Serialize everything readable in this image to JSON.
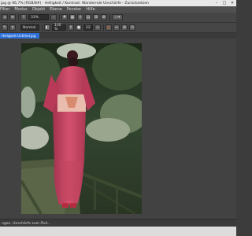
{
  "window": {
    "title": "jpg @ 66,7% (RGB/8#) - Helligkeit / Kontrast: Wandernde Unschärfe - Zurücksetzen",
    "minimize": "–",
    "maximize": "□",
    "close": "✕"
  },
  "menu": [
    "Filter",
    "Modus",
    "Objekt",
    "Ebene",
    "Fenster",
    "Hilfe"
  ],
  "toolbar1": {
    "zoom_value": "33%",
    "icons": [
      "home-icon",
      "menu-icon",
      "arrow-icon",
      "zoom-out-icon",
      "grid-icon",
      "settings-icon",
      "view-icon"
    ]
  },
  "toolbar2": {
    "mode_value": "Normal",
    "opacity_value": "100 %",
    "size_value": "22",
    "icons": [
      "brush-icon",
      "mode-icon",
      "link-icon",
      "target-icon"
    ]
  },
  "tab": {
    "label": "Helligkeit-Untitled.jpg"
  },
  "status": {
    "text": "ngen, Unschärfe zum Änd..."
  },
  "colors": {
    "chrome": "#3c3c3c",
    "tab_active": "#2b6ed8",
    "kimono": "#c0435f",
    "obi": "#e8b8a8"
  }
}
